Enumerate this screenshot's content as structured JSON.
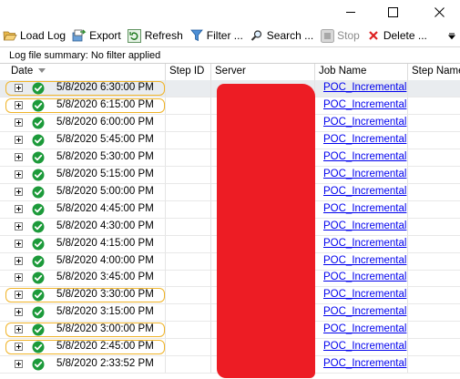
{
  "window": {
    "controls": [
      "minimize",
      "maximize",
      "close"
    ]
  },
  "toolbar": {
    "items": [
      {
        "name": "load-log-button",
        "icon": "folder-open-icon",
        "label": "Load Log",
        "enabled": true
      },
      {
        "name": "export-button",
        "icon": "export-icon",
        "label": "Export",
        "enabled": true
      },
      {
        "name": "refresh-button",
        "icon": "refresh-icon",
        "label": "Refresh",
        "enabled": true
      },
      {
        "name": "filter-button",
        "icon": "filter-icon",
        "label": "Filter ...",
        "enabled": true
      },
      {
        "name": "search-button",
        "icon": "magnifier-icon",
        "label": "Search ...",
        "enabled": true
      },
      {
        "name": "stop-button",
        "icon": "stop-icon",
        "label": "Stop",
        "enabled": false
      },
      {
        "name": "delete-button",
        "icon": "delete-x-icon",
        "label": "Delete ...",
        "enabled": true
      }
    ]
  },
  "summary": "Log file summary: No filter applied",
  "grid": {
    "columns": [
      "Date",
      "Step ID",
      "Server",
      "Job Name",
      "Step Name"
    ],
    "rows": [
      {
        "date": "5/8/2020 6:30:00 PM",
        "job": "POC_Incremental",
        "status": "success",
        "highlighted": true,
        "selected": true
      },
      {
        "date": "5/8/2020 6:15:00 PM",
        "job": "POC_Incremental",
        "status": "success",
        "highlighted": true
      },
      {
        "date": "5/8/2020 6:00:00 PM",
        "job": "POC_Incremental",
        "status": "success"
      },
      {
        "date": "5/8/2020 5:45:00 PM",
        "job": "POC_Incremental",
        "status": "success"
      },
      {
        "date": "5/8/2020 5:30:00 PM",
        "job": "POC_Incremental",
        "status": "success"
      },
      {
        "date": "5/8/2020 5:15:00 PM",
        "job": "POC_Incremental",
        "status": "success"
      },
      {
        "date": "5/8/2020 5:00:00 PM",
        "job": "POC_Incremental",
        "status": "success"
      },
      {
        "date": "5/8/2020 4:45:00 PM",
        "job": "POC_Incremental",
        "status": "success"
      },
      {
        "date": "5/8/2020 4:30:00 PM",
        "job": "POC_Incremental",
        "status": "success"
      },
      {
        "date": "5/8/2020 4:15:00 PM",
        "job": "POC_Incremental",
        "status": "success"
      },
      {
        "date": "5/8/2020 4:00:00 PM",
        "job": "POC_Incremental",
        "status": "success"
      },
      {
        "date": "5/8/2020 3:45:00 PM",
        "job": "POC_Incremental",
        "status": "success"
      },
      {
        "date": "5/8/2020 3:30:00 PM",
        "job": "POC_Incremental",
        "status": "success",
        "highlighted": true
      },
      {
        "date": "5/8/2020 3:15:00 PM",
        "job": "POC_Incremental",
        "status": "success"
      },
      {
        "date": "5/8/2020 3:00:00 PM",
        "job": "POC_Incremental",
        "status": "success",
        "highlighted": true
      },
      {
        "date": "5/8/2020 2:45:00 PM",
        "job": "POC_Incremental",
        "status": "success",
        "highlighted": true
      },
      {
        "date": "5/8/2020 2:33:52 PM",
        "job": "POC_Incremental",
        "status": "success"
      }
    ]
  },
  "colors": {
    "link": "#0000ee",
    "success": "#1c9a3a",
    "highlight": "#f0b429",
    "redaction": "#ed1c24",
    "selected_row": "#e9ecef"
  }
}
